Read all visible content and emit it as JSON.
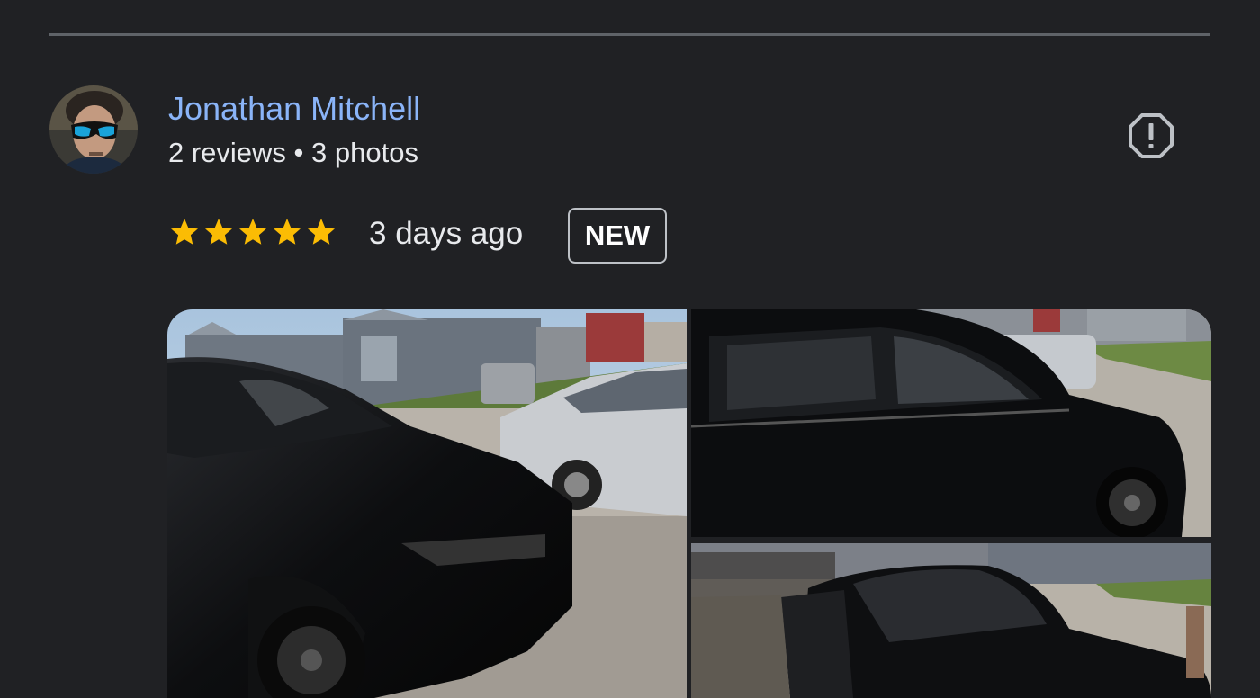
{
  "review": {
    "reviewer_name": "Jonathan Mitchell",
    "reviewer_meta": "2 reviews • 3 photos",
    "rating": 5,
    "rating_max": 5,
    "date": "3 days ago",
    "badge": "NEW",
    "report_icon": "report-flag-icon",
    "star_color": "#fbbc04",
    "name_color": "#8ab4f8"
  },
  "photos": [
    {
      "name": "review-photo-1",
      "subject": "black SUV front with silver car parked behind"
    },
    {
      "name": "review-photo-2",
      "subject": "black SUV side view"
    },
    {
      "name": "review-photo-3",
      "subject": "black SUV with open door"
    }
  ]
}
